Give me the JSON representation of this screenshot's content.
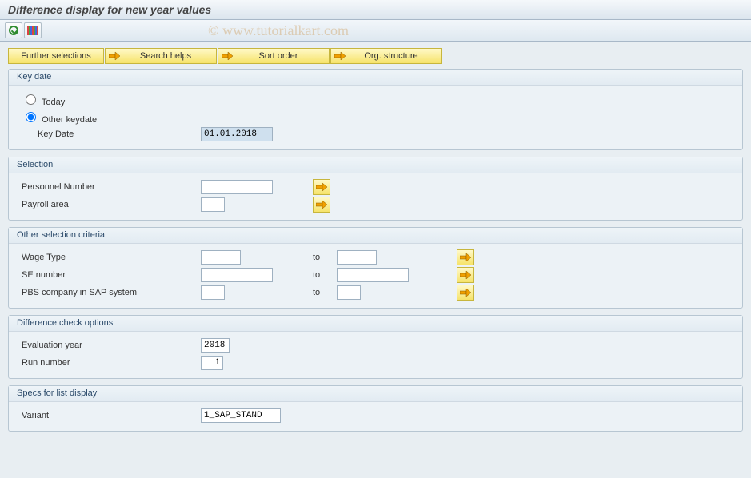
{
  "title": "Difference display for new year values",
  "watermark": "© www.tutorialkart.com",
  "topButtons": {
    "further": "Further selections",
    "search": "Search helps",
    "sort": "Sort order",
    "org": "Org. structure"
  },
  "groups": {
    "keydate": {
      "legend": "Key date",
      "today": "Today",
      "other": "Other keydate",
      "keyDateLabel": "Key Date",
      "keyDateValue": "01.01.2018",
      "selected": "other"
    },
    "selection": {
      "legend": "Selection",
      "personnel": "Personnel Number",
      "payroll": "Payroll area",
      "personnelValue": "",
      "payrollValue": ""
    },
    "other": {
      "legend": "Other selection criteria",
      "wage": "Wage Type",
      "se": "SE number",
      "pbs": "PBS company in SAP system",
      "to": "to"
    },
    "diff": {
      "legend": "Difference check options",
      "evalYear": "Evaluation year",
      "evalYearValue": "2018",
      "runNumber": "Run number",
      "runNumberValue": "1"
    },
    "specs": {
      "legend": "Specs for list display",
      "variant": "Variant",
      "variantValue": "1_SAP_STAND"
    }
  }
}
